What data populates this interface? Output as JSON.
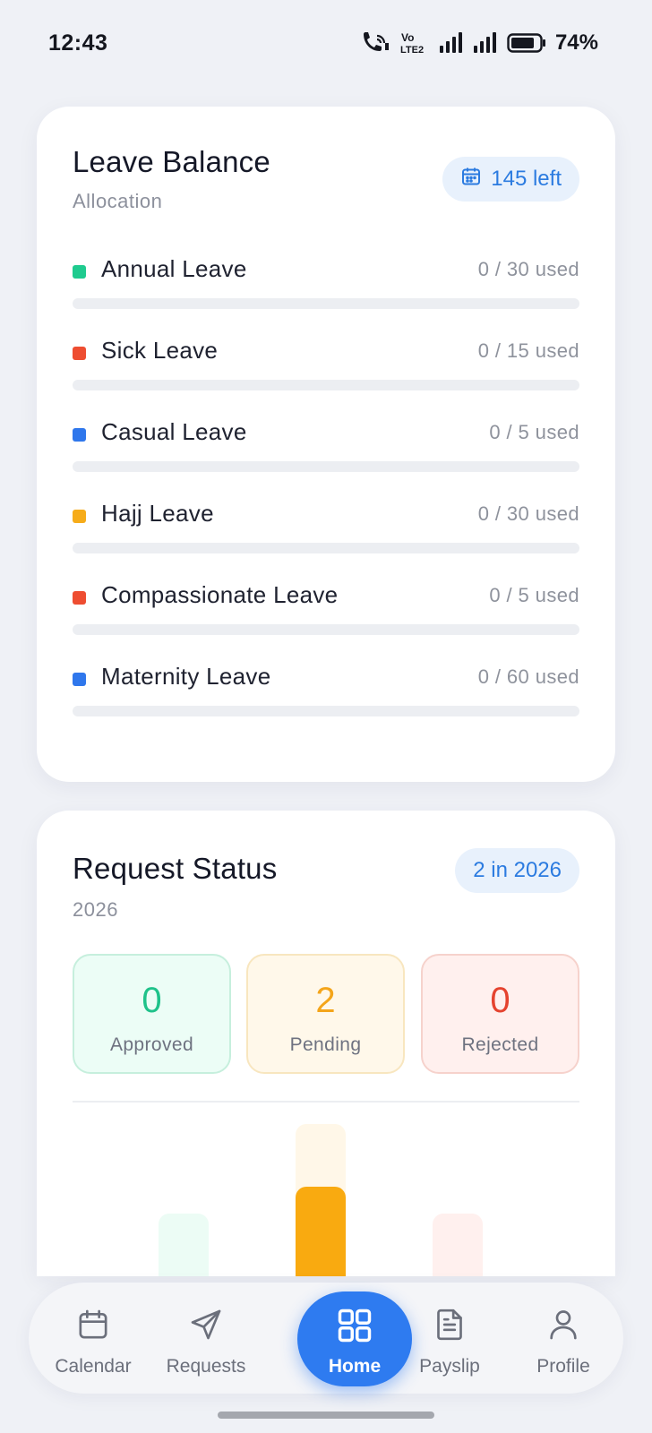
{
  "status_bar": {
    "time": "12:43",
    "network": "Vo LTE2",
    "battery": "74%"
  },
  "leave_balance": {
    "title": "Leave Balance",
    "subtitle": "Allocation",
    "badge": "145 left",
    "badge_icon": "calendar-icon",
    "items": [
      {
        "name": "Annual Leave",
        "used": 0,
        "total": 30,
        "used_text": "0 / 30 used",
        "color": "#1fcb8f"
      },
      {
        "name": "Sick Leave",
        "used": 0,
        "total": 15,
        "used_text": "0 / 15 used",
        "color": "#ee4d31"
      },
      {
        "name": "Casual Leave",
        "used": 0,
        "total": 5,
        "used_text": "0 / 5 used",
        "color": "#2f77ec"
      },
      {
        "name": "Hajj Leave",
        "used": 0,
        "total": 30,
        "used_text": "0 / 30 used",
        "color": "#f6ac1a"
      },
      {
        "name": "Compassionate Leave",
        "used": 0,
        "total": 5,
        "used_text": "0 / 5 used",
        "color": "#ee4d31"
      },
      {
        "name": "Maternity Leave",
        "used": 0,
        "total": 60,
        "used_text": "0 / 60 used",
        "color": "#2f77ec"
      }
    ]
  },
  "request_status": {
    "title": "Request Status",
    "subtitle": "2026",
    "badge": "2 in 2026",
    "stats": [
      {
        "value": "0",
        "label": "Approved",
        "color": "#1fc28a",
        "bg": "#ecfdf6",
        "border": "#c6efdd"
      },
      {
        "value": "2",
        "label": "Pending",
        "color": "#f4a51a",
        "bg": "#fff8ea",
        "border": "#f8e6bf"
      },
      {
        "value": "0",
        "label": "Rejected",
        "color": "#e5432f",
        "bg": "#fff0ee",
        "border": "#f6d2cc"
      }
    ]
  },
  "chart_data": {
    "type": "bar",
    "categories": [
      "Approved",
      "Pending",
      "Rejected"
    ],
    "values": [
      0,
      2,
      0
    ],
    "colors": [
      "#1fc28a",
      "#f9aa10",
      "#e5432f"
    ],
    "ylim": [
      0,
      2
    ],
    "grid": false,
    "legend": "none"
  },
  "nav": {
    "items": [
      {
        "label": "Calendar",
        "icon": "calendar-icon",
        "active": false
      },
      {
        "label": "Requests",
        "icon": "send-icon",
        "active": false
      },
      {
        "label": "Home",
        "icon": "grid-icon",
        "active": true
      },
      {
        "label": "Payslip",
        "icon": "document-icon",
        "active": false
      },
      {
        "label": "Profile",
        "icon": "user-icon",
        "active": false
      }
    ]
  }
}
